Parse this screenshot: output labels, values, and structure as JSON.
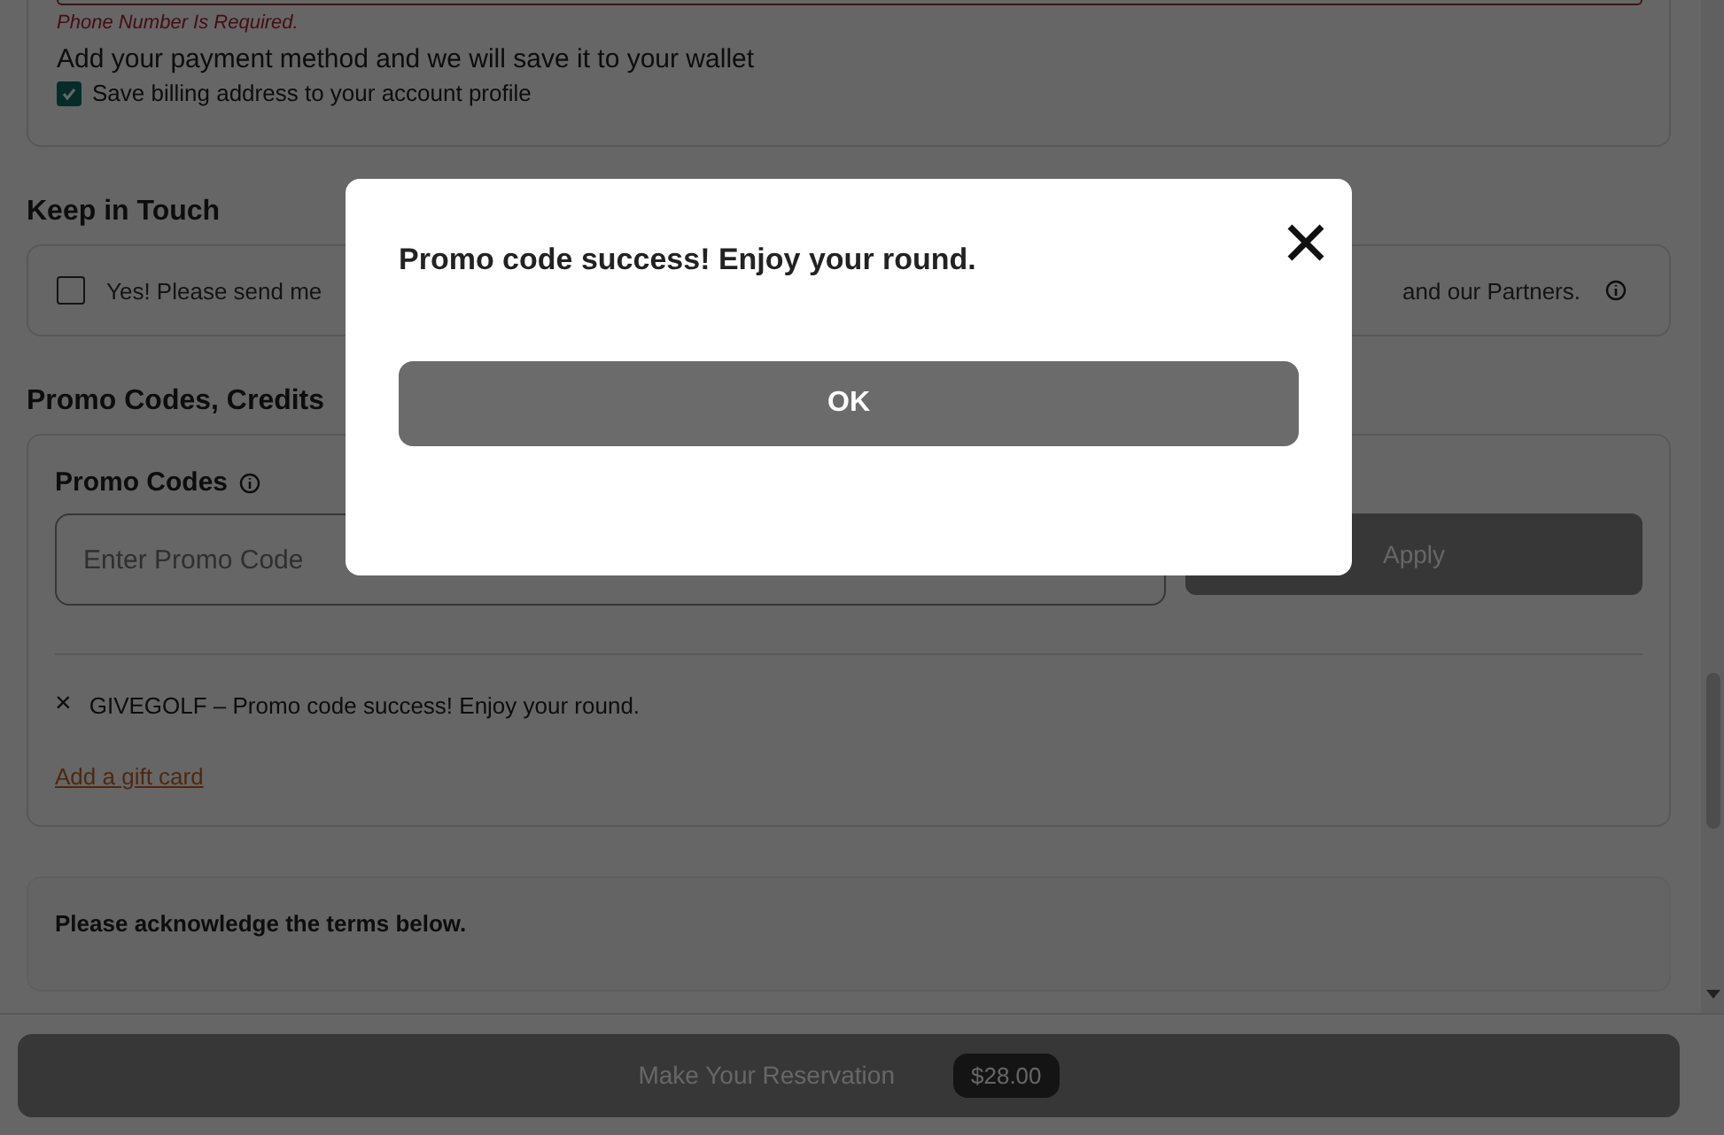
{
  "payment": {
    "error": "Phone Number Is Required.",
    "note": "Add your payment method and we will save it to your wallet",
    "save_billing": {
      "label": "Save billing address to your account profile",
      "checked": true
    }
  },
  "keep_in_touch": {
    "title": "Keep in Touch",
    "opt_in": {
      "label_start": "Yes! Please send me",
      "label_end": "and our Partners.",
      "checked": false
    }
  },
  "promo": {
    "title": "Promo Codes, Credits",
    "label": "Promo Codes",
    "placeholder": "Enter Promo Code",
    "apply": {
      "label": "Apply",
      "disabled": true
    },
    "applied": [
      {
        "remove": "×",
        "text": "GIVEGOLF – Promo code success! Enjoy your round."
      }
    ],
    "gift_card_link": "Add a gift card"
  },
  "terms": {
    "title": "Please acknowledge the terms below."
  },
  "footer": {
    "button": {
      "label": "Make Your Reservation",
      "disabled": true
    },
    "price": "$28.00"
  },
  "modal": {
    "message": "Promo code success! Enjoy your round.",
    "ok": "OK"
  }
}
